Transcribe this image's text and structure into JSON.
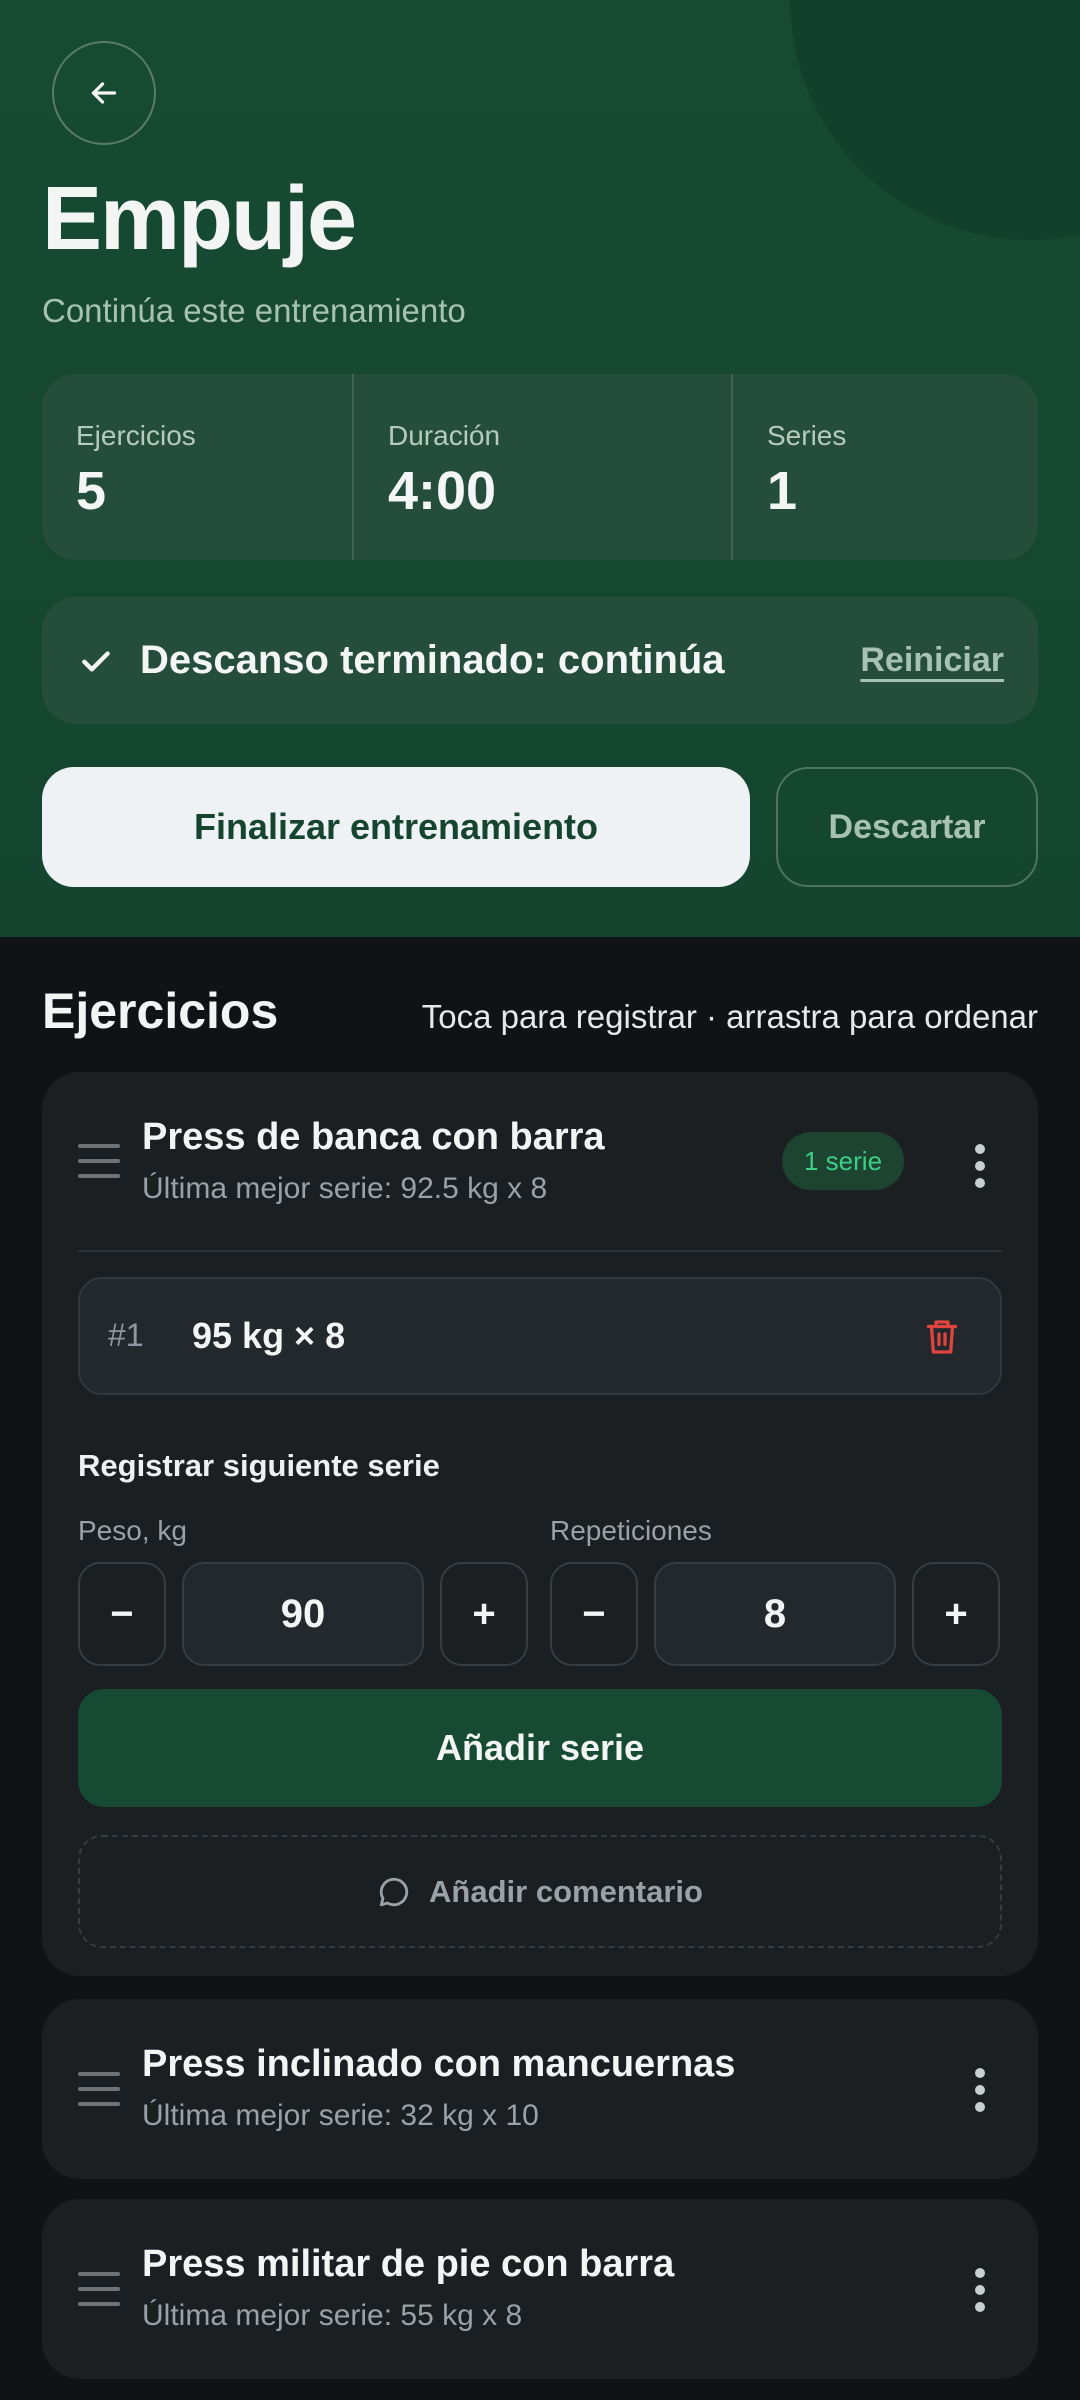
{
  "header": {
    "back_icon": "arrow-left-icon",
    "title": "Empuje",
    "subtitle": "Continúa este entrenamiento",
    "stats": [
      {
        "label": "Ejercicios",
        "value": "5"
      },
      {
        "label": "Duración",
        "value": "4:00"
      },
      {
        "label": "Series",
        "value": "1"
      }
    ],
    "rest": {
      "icon": "check-icon",
      "text": "Descanso terminado: continúa",
      "reset_label": "Reiniciar"
    },
    "finish_label": "Finalizar entrenamiento",
    "discard_label": "Descartar"
  },
  "exercises_section": {
    "title": "Ejercicios",
    "hint": "Toca para registrar · arrastra para ordenar"
  },
  "exercises": [
    {
      "name": "Press de banca con barra",
      "best": "Última mejor serie: 92.5 kg x 8",
      "badge": "1 serie",
      "sets": [
        {
          "num": "#1",
          "value": "95 kg × 8"
        }
      ],
      "next_set": {
        "title": "Registrar siguiente serie",
        "weight_label": "Peso, kg",
        "weight_value": "90",
        "reps_label": "Repeticiones",
        "reps_value": "8",
        "minus": "−",
        "plus": "+"
      },
      "add_set_label": "Añadir serie",
      "comment_label": "Añadir comentario"
    },
    {
      "name": "Press inclinado con mancuernas",
      "best": "Última mejor serie: 32 kg x 10"
    },
    {
      "name": "Press militar de pie con barra",
      "best": "Última mejor serie: 55 kg x 8"
    }
  ],
  "colors": {
    "header_bg": "#164a33",
    "accent_green": "#3ecf87",
    "danger": "#e0443e",
    "card_bg": "#1b1f22",
    "page_bg": "#0f1316"
  }
}
